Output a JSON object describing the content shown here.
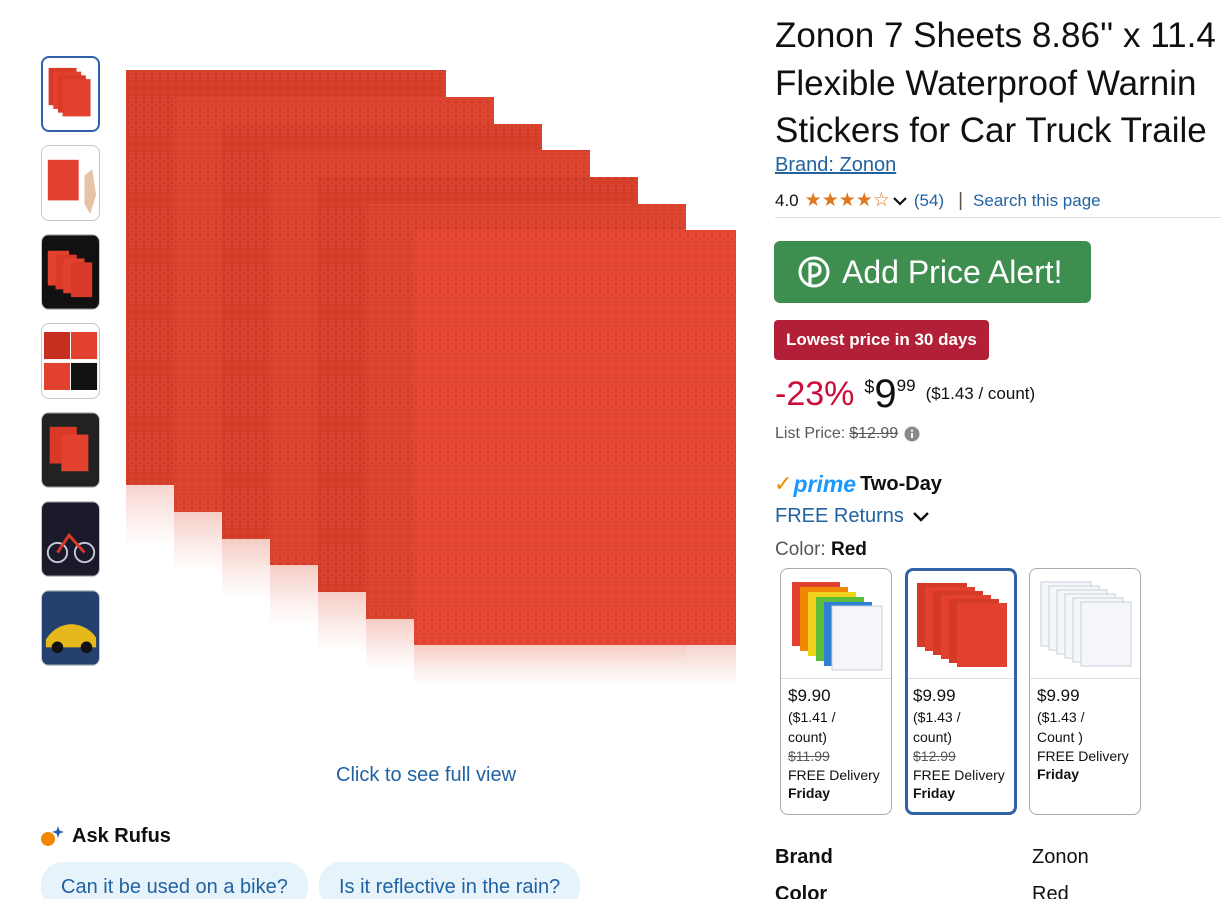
{
  "product": {
    "title_lines": [
      "Zonon 7 Sheets 8.86'' x 11.4",
      "Flexible Waterproof Warnin",
      "Stickers for Car Truck Traile"
    ],
    "brand": "Brand: Zonon",
    "rating": "4.0",
    "rating_count": "(54)",
    "separator": "|",
    "search_page": "Search this page"
  },
  "alert_button": {
    "label": "Add Price Alert!",
    "icon": "pricealert-p-icon"
  },
  "badge": "Lowest price in 30 days",
  "price": {
    "discount": "-23%",
    "symbol": "$",
    "whole": "9",
    "fraction": "99",
    "unit_price": "($1.43 / count)",
    "list_label": "List Price:",
    "list_value": "$12.99"
  },
  "delivery": {
    "prime": "prime",
    "speed": "Two-Day",
    "returns": "FREE Returns"
  },
  "color": {
    "label": "Color:",
    "value": "Red"
  },
  "swatches": [
    {
      "price": "$9.90",
      "unit_a": "($1.41 /",
      "unit_b": "count)",
      "old": "$11.99",
      "delivery": "FREE Delivery",
      "day": "Friday"
    },
    {
      "price": "$9.99",
      "unit_a": "($1.43 /",
      "unit_b": "count)",
      "old": "$12.99",
      "delivery": "FREE Delivery",
      "day": "Friday"
    },
    {
      "price": "$9.99",
      "unit_a": "($1.43 /",
      "unit_b": "Count )",
      "old": "",
      "delivery": "FREE Delivery",
      "day": "Friday"
    }
  ],
  "specs": [
    {
      "key": "Brand",
      "value": "Zonon"
    },
    {
      "key": "Color",
      "value": "Red"
    }
  ],
  "gallery": {
    "full_view": "Click to see full view"
  },
  "rufus": {
    "title": "Ask Rufus",
    "questions": [
      "Can it be used on a bike?",
      "Is it reflective in the rain?"
    ]
  },
  "colors": {
    "accent_link": "#2162a1",
    "alert_green": "#3e8e4f",
    "badge_red": "#b12036",
    "discount_red": "#cc0c39",
    "sheet_red": "#e2412f"
  }
}
